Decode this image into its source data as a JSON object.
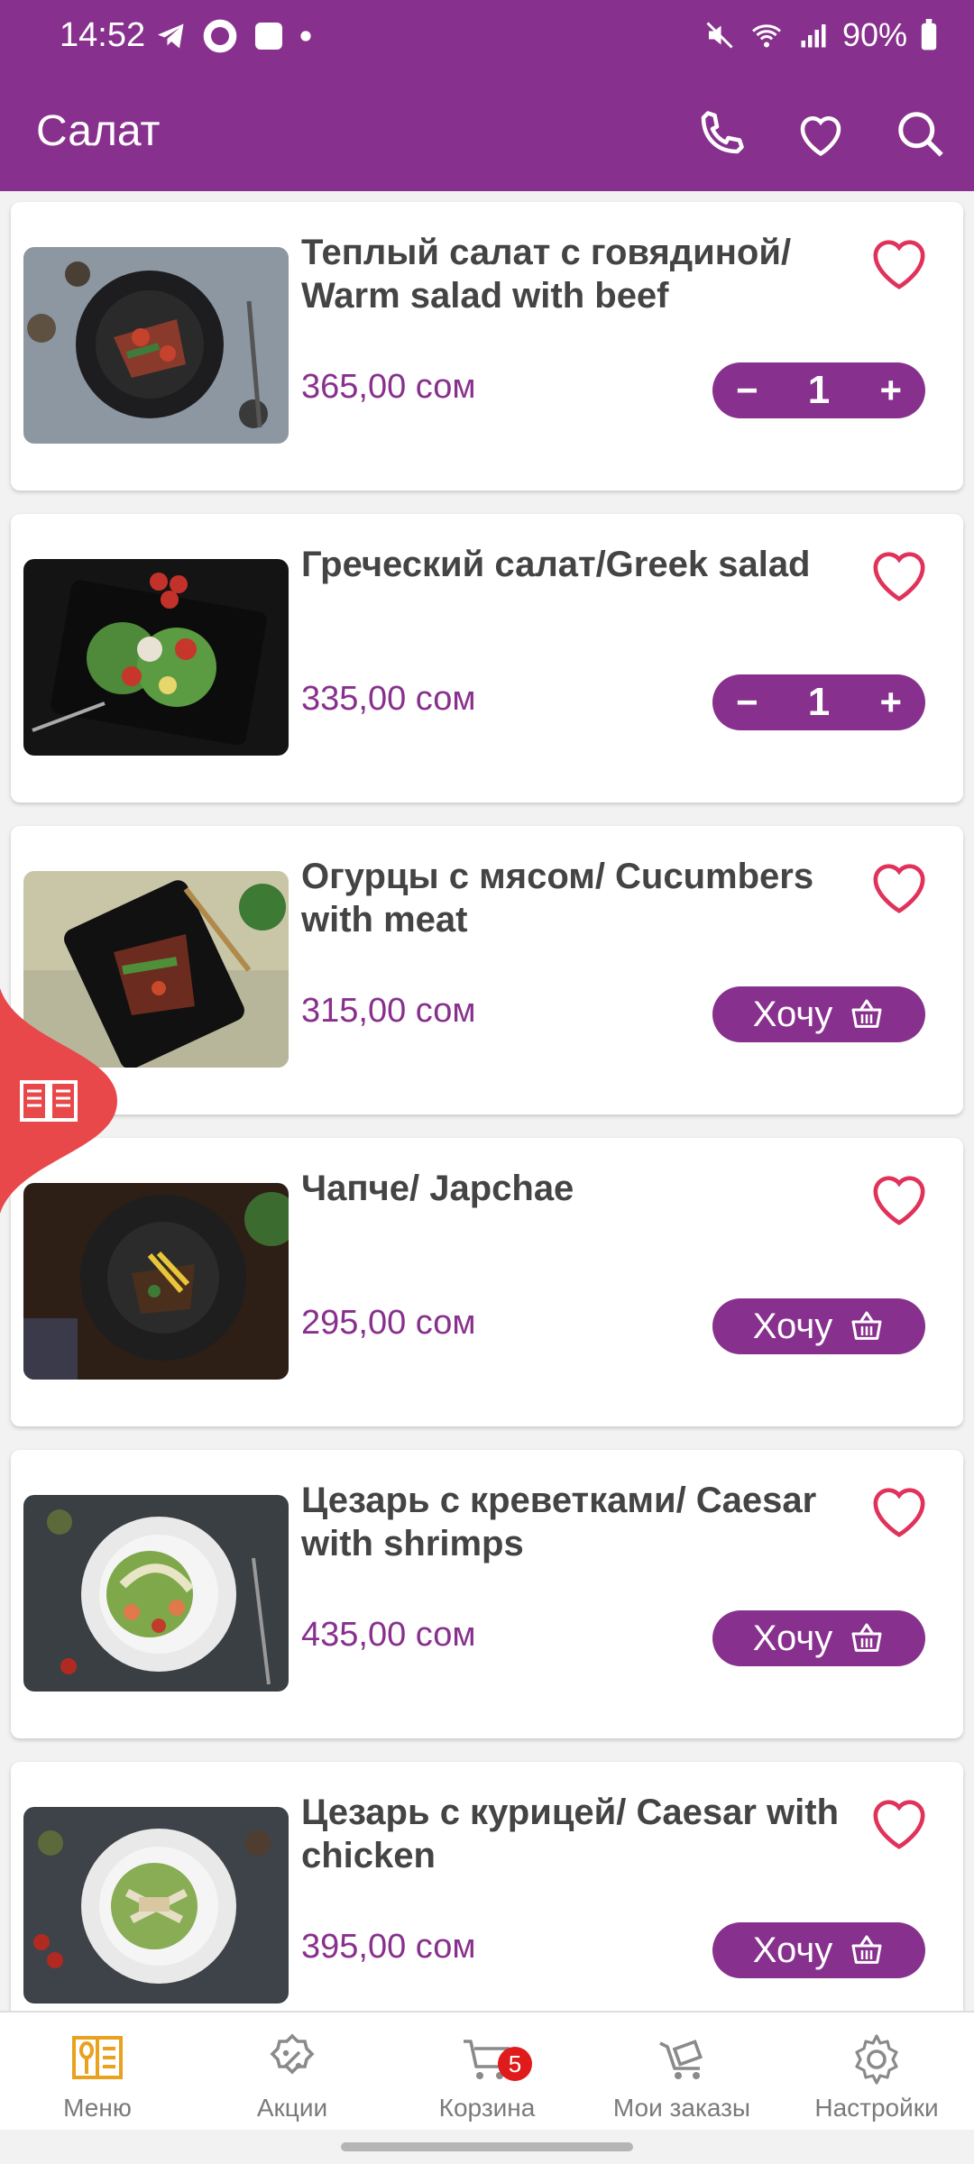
{
  "status": {
    "time": "14:52",
    "battery": "90%"
  },
  "appbar": {
    "title": "Салат"
  },
  "items": [
    {
      "name": "Теплый салат с говядиной/ Warm salad with beef",
      "price": "365,00 сом",
      "qty": "1"
    },
    {
      "name": "Греческий салат/Greek salad",
      "price": "335,00 сом",
      "qty": "1"
    },
    {
      "name": "Огурцы с мясом/ Cucumbers with meat",
      "price": "315,00 сом",
      "button": "Хочу"
    },
    {
      "name": "Чапче/ Japchae",
      "price": "295,00 сом",
      "button": "Хочу"
    },
    {
      "name": "Цезарь с креветками/ Caesar with shrimps",
      "price": "435,00 сом",
      "button": "Хочу"
    },
    {
      "name": "Цезарь с курицей/ Caesar with chicken",
      "price": "395,00 сом",
      "button": "Хочу"
    }
  ],
  "qty_controls": {
    "minus": "−",
    "plus": "+"
  },
  "nav": {
    "tabs": [
      {
        "label": "Меню",
        "icon": "menu-book-icon"
      },
      {
        "label": "Акции",
        "icon": "discount-icon"
      },
      {
        "label": "Корзина",
        "icon": "cart-icon"
      },
      {
        "label": "Мои заказы",
        "icon": "orders-cart-icon"
      },
      {
        "label": "Настройки",
        "icon": "gear-icon"
      }
    ],
    "cart_badge": "5"
  },
  "colors": {
    "brand": "#88308d",
    "heart": "#e0325a",
    "menu_active": "#e8a21e",
    "float_tab": "#e8484a"
  }
}
